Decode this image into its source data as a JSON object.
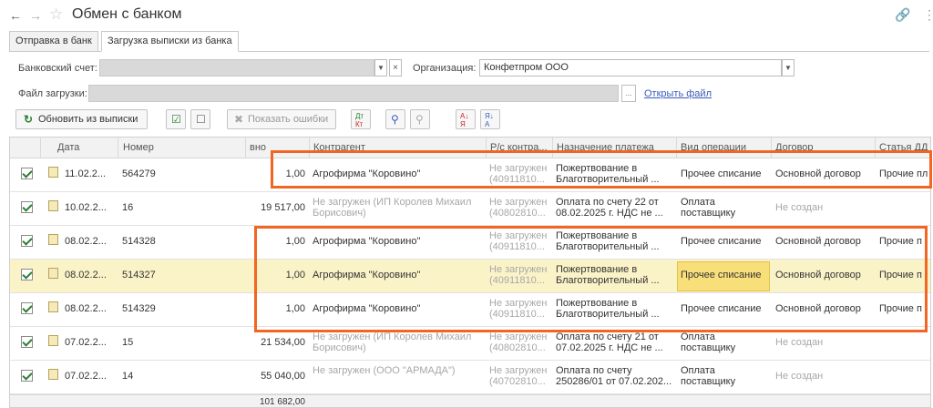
{
  "window": {
    "title": "Обмен с банком"
  },
  "icons": {
    "back": "arrow-left-icon",
    "forward": "arrow-right-icon",
    "star": "star-icon",
    "link": "link-icon",
    "more": "more-icon"
  },
  "tabs": [
    "Отправка в банк",
    "Загрузка выписки из банка"
  ],
  "form": {
    "bank_account_label": "Банковский счет:",
    "org_label": "Организация:",
    "org_value": "Конфетпром ООО",
    "file_label": "Файл загрузки:",
    "browse": "...",
    "open_file": "Открыть файл"
  },
  "toolbar": {
    "refresh": "Обновить из выписки",
    "show_errors": "Показать ошибки"
  },
  "table": {
    "headers": [
      "Дата",
      "Номер",
      "вно",
      "Контрагент",
      "Р/с контра...",
      "Назначение платежа",
      "Вид операции",
      "Договор",
      "Статья ДД"
    ],
    "rows": [
      {
        "date": "11.02.2...",
        "number": "564279",
        "sum": "1,00",
        "counterparty": "Агрофирма \"Коровино\"",
        "cp_muted": false,
        "account": "Не загружен (40911810...",
        "purpose": "Пожертвование в Благотворительный ...",
        "operation": "Прочее списание",
        "contract": "Основной договор",
        "contract_muted": false,
        "article": "Прочие пл"
      },
      {
        "date": "10.02.2...",
        "number": "16",
        "sum": "19 517,00",
        "counterparty": "Не загружен (ИП Королев Михаил Борисович)",
        "cp_muted": true,
        "account": "Не загружен (40802810...",
        "purpose": "Оплата по счету 22 от 08.02.2025 г. НДС не ...",
        "operation": "Оплата поставщику",
        "contract": "Не создан",
        "contract_muted": true,
        "article": ""
      },
      {
        "date": "08.02.2...",
        "number": "514328",
        "sum": "1,00",
        "counterparty": "Агрофирма \"Коровино\"",
        "cp_muted": false,
        "account": "Не загружен (40911810...",
        "purpose": "Пожертвование в Благотворительный ...",
        "operation": "Прочее списание",
        "contract": "Основной договор",
        "contract_muted": false,
        "article": "Прочие п"
      },
      {
        "date": "08.02.2...",
        "number": "514327",
        "sum": "1,00",
        "counterparty": "Агрофирма \"Коровино\"",
        "cp_muted": false,
        "account": "Не загружен (40911810...",
        "purpose": "Пожертвование в Благотворительный ...",
        "operation": "Прочее списание",
        "contract": "Основной договор",
        "contract_muted": false,
        "article": "Прочие п"
      },
      {
        "date": "08.02.2...",
        "number": "514329",
        "sum": "1,00",
        "counterparty": "Агрофирма \"Коровино\"",
        "cp_muted": false,
        "account": "Не загружен (40911810...",
        "purpose": "Пожертвование в Благотворительный ...",
        "operation": "Прочее списание",
        "contract": "Основной договор",
        "contract_muted": false,
        "article": "Прочие п"
      },
      {
        "date": "07.02.2...",
        "number": "15",
        "sum": "21 534,00",
        "counterparty": "Не загружен (ИП Королев Михаил Борисович)",
        "cp_muted": true,
        "account": "Не загружен (40802810...",
        "purpose": "Оплата по счету 21 от 07.02.2025 г. НДС не ...",
        "operation": "Оплата поставщику",
        "contract": "Не создан",
        "contract_muted": true,
        "article": ""
      },
      {
        "date": "07.02.2...",
        "number": "14",
        "sum": "55 040,00",
        "counterparty": "Не загружен (ООО \"АРМАДА\")",
        "cp_muted": true,
        "account": "Не загружен (40702810...",
        "purpose": "Оплата по счету 250286/01 от 07.02.202...",
        "operation": "Оплата поставщику",
        "contract": "Не создан",
        "contract_muted": true,
        "article": ""
      }
    ],
    "total": "101 682,00"
  },
  "colors": {
    "highlight": "#f26522",
    "selected_row": "#fbf3c8",
    "active_cell": "#f9df7a",
    "link": "#3c5bbd"
  }
}
